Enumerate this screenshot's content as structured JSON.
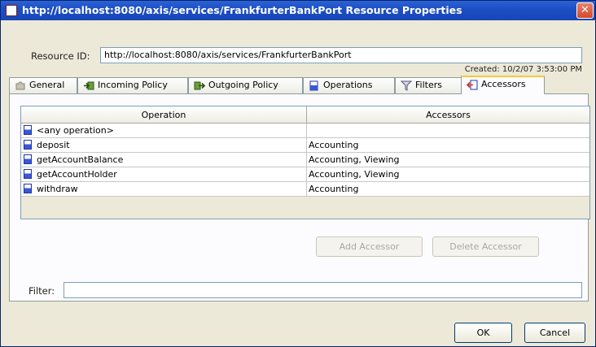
{
  "window": {
    "title": "http://localhost:8080/axis/services/FrankfurterBankPort Resource Properties",
    "close_glyph": "✕"
  },
  "resource": {
    "label": "Resource ID:",
    "value": "http://localhost:8080/axis/services/FrankfurterBankPort",
    "created": "Created: 10/2/07 3:53:00 PM"
  },
  "tabs": [
    {
      "label": "General",
      "icon": "puzzle-icon"
    },
    {
      "label": "Incoming Policy",
      "icon": "incoming-arrow-icon"
    },
    {
      "label": "Outgoing Policy",
      "icon": "outgoing-arrow-icon"
    },
    {
      "label": "Operations",
      "icon": "operation-icon"
    },
    {
      "label": "Filters",
      "icon": "funnel-icon"
    },
    {
      "label": "Accessors",
      "icon": "accessor-icon",
      "active": true
    }
  ],
  "table": {
    "columns": [
      "Operation",
      "Accessors"
    ],
    "rows": [
      {
        "operation": "<any operation>",
        "accessors": ""
      },
      {
        "operation": "deposit",
        "accessors": "Accounting"
      },
      {
        "operation": "getAccountBalance",
        "accessors": "Accounting, Viewing"
      },
      {
        "operation": "getAccountHolder",
        "accessors": "Accounting, Viewing"
      },
      {
        "operation": "withdraw",
        "accessors": "Accounting"
      }
    ]
  },
  "buttons": {
    "add_accessor": "Add Accessor",
    "delete_accessor": "Delete Accessor",
    "ok": "OK",
    "cancel": "Cancel"
  },
  "filter": {
    "label": "Filter:",
    "value": ""
  }
}
